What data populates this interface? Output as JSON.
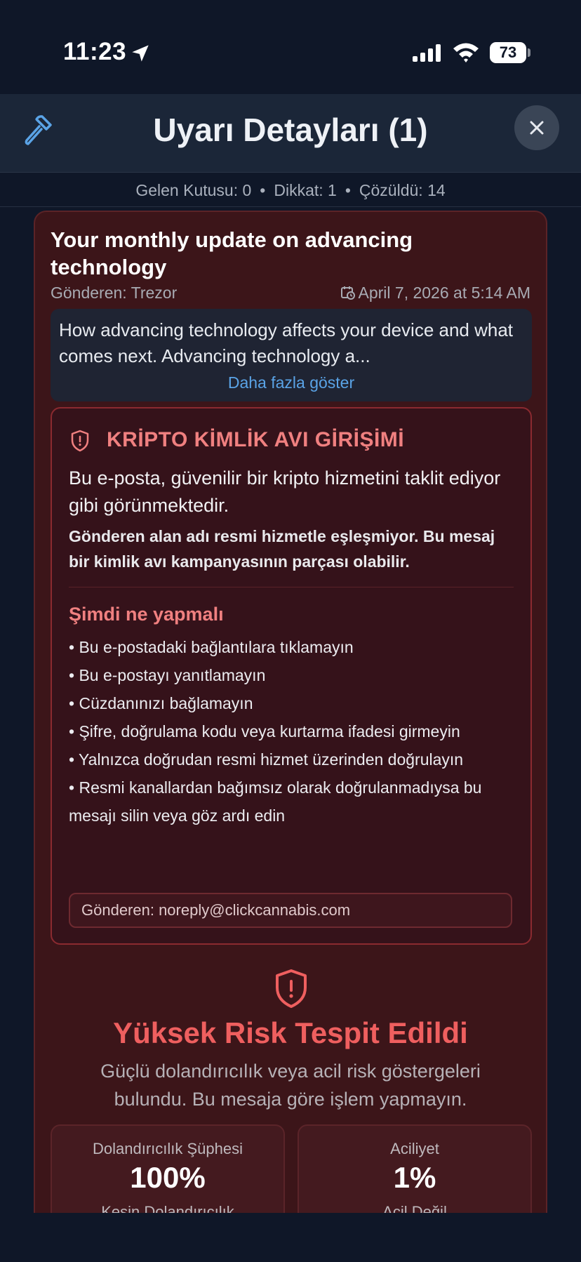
{
  "status_bar": {
    "time": "11:23",
    "battery": "73",
    "icons": [
      "location-arrow-icon",
      "cellular-signal-icon",
      "wifi-icon",
      "battery-icon"
    ]
  },
  "header": {
    "title": "Uyarı Detayları (1)",
    "left_icon": "hammer-icon",
    "right_icon": "close-icon"
  },
  "stats": {
    "inbox": "Gelen Kutusu: 0",
    "attention": "Dikkat: 1",
    "resolved": "Çözüldü: 14",
    "separator": "•"
  },
  "email": {
    "subject": "Your monthly update on advancing technology",
    "sender": "Gönderen: Trezor",
    "date": "April 7, 2026 at 5:14 AM",
    "preview": "How advancing technology affects your device and what comes next.  Advancing technology a...",
    "show_more": "Daha fazla göster"
  },
  "alert": {
    "title": "KRİPTO KİMLİK AVI GİRİŞİMİ",
    "description": "Bu e-posta, güvenilir bir kripto hizmetini taklit ediyor gibi görünmektedir.",
    "detail": "Gönderen alan adı resmi hizmetle eşleşmiyor. Bu mesaj bir kimlik avı kampanyasının parçası olabilir.",
    "todo_title": "Şimdi ne yapmalı",
    "todo": [
      "Bu e-postadaki bağlantılara tıklamayın",
      "Bu e-postayı yanıtlamayın",
      "Cüzdanınızı bağlamayın",
      "Şifre, doğrulama kodu veya kurtarma ifadesi girmeyin",
      "Yalnızca doğrudan resmi hizmet üzerinden doğrulayın",
      "Resmi kanallardan bağımsız olarak doğrulanmadıysa bu mesajı silin veya göz ardı edin"
    ],
    "sender_email": "Gönderen: noreply@clickcannabis.com"
  },
  "risk": {
    "title": "Yüksek Risk Tespit Edildi",
    "description": "Güçlü dolandırıcılık veya acil risk göstergeleri bulundu. Bu mesaja göre işlem yapmayın.",
    "metrics": [
      {
        "label": "Dolandırıcılık Şüphesi",
        "value": "100%",
        "sub": "Kesin Dolandırıcılık"
      },
      {
        "label": "Aciliyet",
        "value": "1%",
        "sub": "Acil Değil"
      }
    ]
  },
  "colors": {
    "background": "#0f1728",
    "header": "#1b2638",
    "card": "#3c1519",
    "alert_accent": "#f08080",
    "risk_red": "#ef5f5f",
    "link": "#5aa3e6"
  }
}
